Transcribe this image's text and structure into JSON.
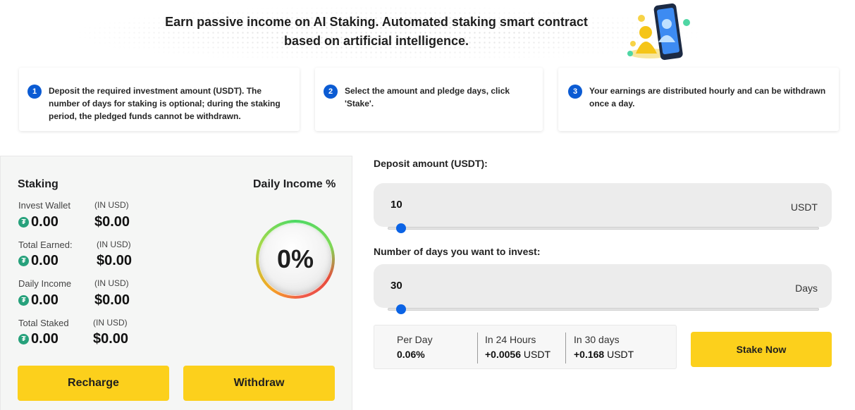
{
  "header": {
    "line1": "Earn passive income on AI Staking. Automated staking smart contract",
    "line2": "based on artificial intelligence."
  },
  "steps": [
    {
      "num": "1",
      "text": "Deposit the required investment amount (USDT). The number of days for staking is optional; during the staking period, the pledged funds cannot be withdrawn."
    },
    {
      "num": "2",
      "text": "Select the amount and pledge days, click 'Stake'."
    },
    {
      "num": "3",
      "text": "Your earnings are distributed hourly and can be withdrawn once a day."
    }
  ],
  "staking": {
    "title": "Staking",
    "income_title": "Daily Income %",
    "income_value": "0%",
    "usd_label": "(IN USD)",
    "tether_symbol": "₮",
    "stats": [
      {
        "label": "Invest Wallet",
        "usdt": "0.00",
        "usd": "$0.00"
      },
      {
        "label": "Total Earned:",
        "usdt": "0.00",
        "usd": "$0.00"
      },
      {
        "label": "Daily Income",
        "usdt": "0.00",
        "usd": "$0.00"
      },
      {
        "label": "Total Staked",
        "usdt": "0.00",
        "usd": "$0.00"
      }
    ],
    "recharge_label": "Recharge",
    "withdraw_label": "Withdraw"
  },
  "deposit": {
    "label": "Deposit amount (USDT):",
    "value": "10",
    "unit": "USDT",
    "slider_fraction": 0.03
  },
  "days": {
    "label": "Number of days you want to invest:",
    "value": "30",
    "unit": "Days",
    "slider_fraction": 0.03
  },
  "summary": {
    "per_day_label": "Per Day",
    "per_day_value": "0.06%",
    "h24_label": "In 24 Hours",
    "h24_value": "+0.0056",
    "h24_unit": "USDT",
    "d30_label": "In 30 days",
    "d30_value": "+0.168",
    "d30_unit": "USDT"
  },
  "stake_label": "Stake Now",
  "colors": {
    "accent_yellow": "#fcd01c",
    "step_blue": "#0b5bd3",
    "slider_blue": "#0b63e5",
    "tether_green": "#26a17b"
  }
}
